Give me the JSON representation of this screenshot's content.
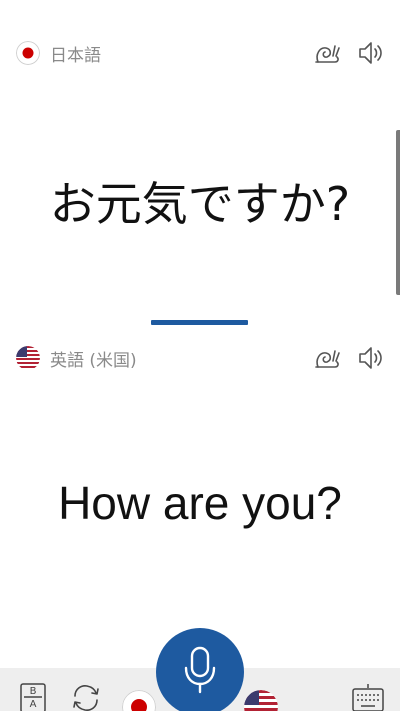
{
  "source_language": {
    "label": "日本語",
    "flag": "japan-flag-icon"
  },
  "target_language": {
    "label": "英語 (米国)",
    "flag": "us-flag-icon"
  },
  "source_phrase": "お元気ですか?",
  "target_phrase": "How are you?",
  "icons": {
    "slow_speech": "snail-icon",
    "speaker": "speaker-icon",
    "microphone": "microphone-icon",
    "dictionary": "dictionary-icon",
    "swap": "swap-icon",
    "keyboard": "keyboard-icon"
  },
  "colors": {
    "accent": "#1e5aa0",
    "label_gray": "#8a8a8a",
    "bottom_bar": "#eeeeee"
  }
}
